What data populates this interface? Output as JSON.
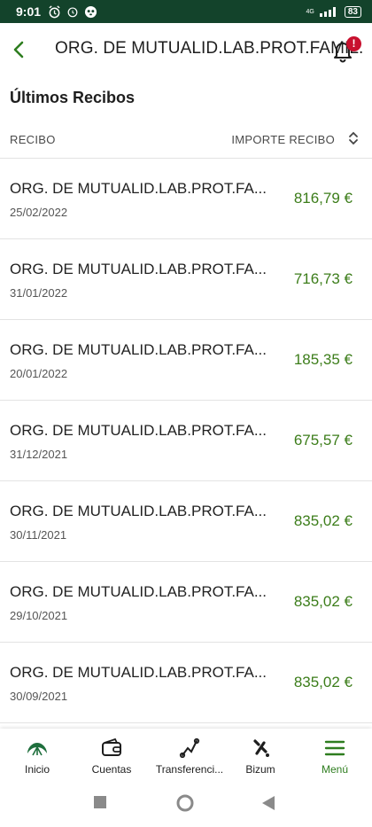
{
  "status_bar": {
    "time": "9:01",
    "network": "4G",
    "battery": "83"
  },
  "header": {
    "title": "ORG. DE MUTUALID.LAB.PROT.FAMIL.",
    "notification_badge": "!"
  },
  "section": {
    "title": "Últimos Recibos"
  },
  "columns": {
    "recibo": "RECIBO",
    "importe": "IMPORTE RECIBO"
  },
  "rows": [
    {
      "name": "ORG. DE MUTUALID.LAB.PROT.FA...",
      "date": "25/02/2022",
      "amount": "816,79 €"
    },
    {
      "name": "ORG. DE MUTUALID.LAB.PROT.FA...",
      "date": "31/01/2022",
      "amount": "716,73 €"
    },
    {
      "name": "ORG. DE MUTUALID.LAB.PROT.FA...",
      "date": "20/01/2022",
      "amount": "185,35 €"
    },
    {
      "name": "ORG. DE MUTUALID.LAB.PROT.FA...",
      "date": "31/12/2021",
      "amount": "675,57 €"
    },
    {
      "name": "ORG. DE MUTUALID.LAB.PROT.FA...",
      "date": "30/11/2021",
      "amount": "835,02 €"
    },
    {
      "name": "ORG. DE MUTUALID.LAB.PROT.FA...",
      "date": "29/10/2021",
      "amount": "835,02 €"
    },
    {
      "name": "ORG. DE MUTUALID.LAB.PROT.FA...",
      "date": "30/09/2021",
      "amount": "835,02 €"
    }
  ],
  "nav": {
    "items": [
      {
        "label": "Inicio",
        "icon": "home-logo-icon"
      },
      {
        "label": "Cuentas",
        "icon": "wallet-icon"
      },
      {
        "label": "Transferenci...",
        "icon": "transfer-icon"
      },
      {
        "label": "Bizum",
        "icon": "bizum-icon"
      },
      {
        "label": "Menú",
        "icon": "menu-icon",
        "active": true
      }
    ]
  },
  "colors": {
    "status_bar": "#13432b",
    "accent_green": "#2e7d1f",
    "amount_green": "#3c7d1a",
    "badge_red": "#c8102e"
  }
}
